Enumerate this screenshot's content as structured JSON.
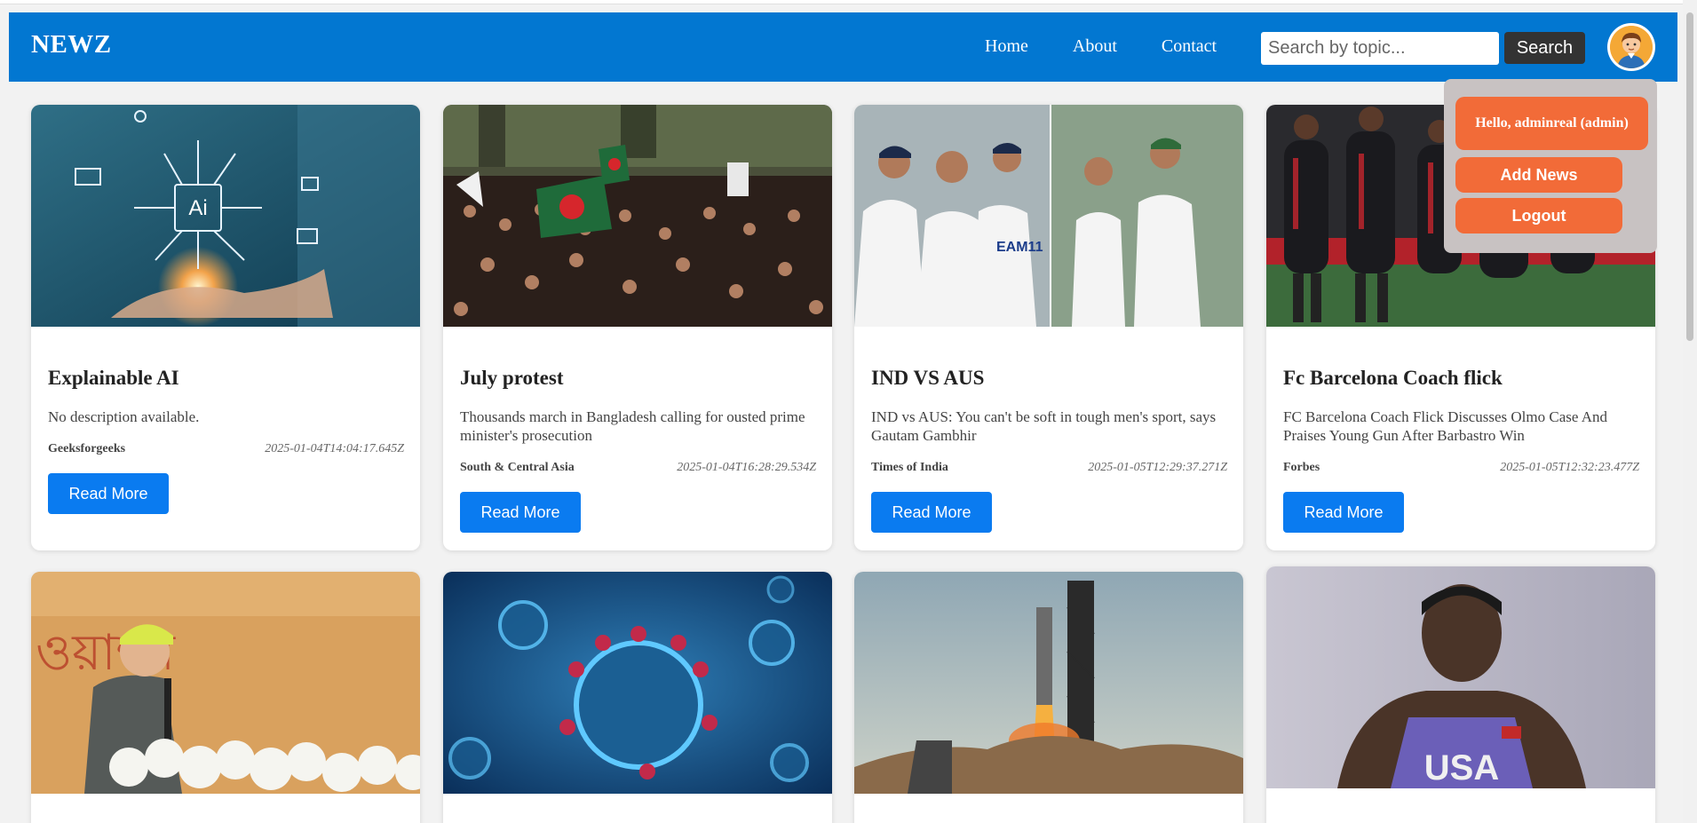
{
  "nav": {
    "brand": "NEWZ",
    "links": [
      "Home",
      "About",
      "Contact"
    ],
    "search_placeholder": "Search by topic...",
    "search_label": "Search"
  },
  "user_menu": {
    "greeting": "Hello, adminreal (admin)",
    "add_news": "Add News",
    "logout": "Logout"
  },
  "articles": [
    {
      "title": "Explainable AI",
      "description": "No description available.",
      "source": "Geeksforgeeks",
      "date": "2025-01-04T14:04:17.645Z",
      "button": "Read More",
      "image": "ai-chip-icon"
    },
    {
      "title": "July protest",
      "description": "Thousands march in Bangladesh calling for ousted prime minister's prosecution",
      "source": "South & Central Asia",
      "date": "2025-01-04T16:28:29.534Z",
      "button": "Read More",
      "image": "crowd-protest-photo"
    },
    {
      "title": "IND VS AUS",
      "description": "IND vs AUS: You can't be soft in tough men's sport, says Gautam Gambhir",
      "source": "Times of India",
      "date": "2025-01-05T12:29:37.271Z",
      "button": "Read More",
      "image": "cricket-players-photo"
    },
    {
      "title": "Fc Barcelona Coach flick",
      "description": "FC Barcelona Coach Flick Discusses Olmo Case And Praises Young Gun After Barbastro Win",
      "source": "Forbes",
      "date": "2025-01-05T12:32:23.477Z",
      "button": "Read More",
      "image": "football-players-photo"
    },
    {
      "image": "speaker-podium-photo"
    },
    {
      "image": "virus-photo"
    },
    {
      "image": "rocket-launch-photo"
    },
    {
      "image": "athlete-usa-photo"
    }
  ]
}
